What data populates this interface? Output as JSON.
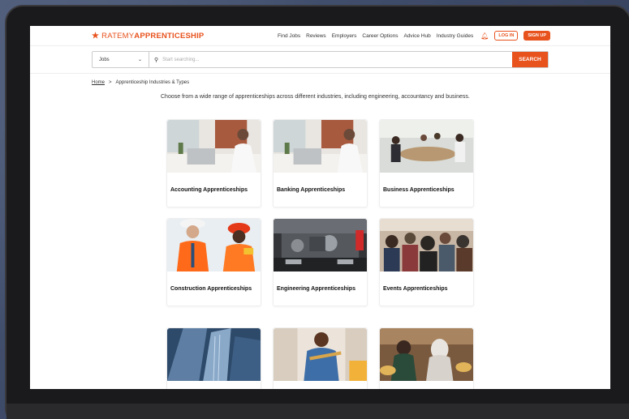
{
  "brand": {
    "prefix": "RATEMY",
    "name": "APPRENTICESHIP"
  },
  "nav": {
    "links": [
      "Find Jobs",
      "Reviews",
      "Employers",
      "Career Options",
      "Advice Hub",
      "Industry Guides"
    ],
    "login": "LOG IN",
    "signup": "SIGN UP"
  },
  "search": {
    "select_value": "Jobs",
    "placeholder": "Start searching...",
    "button": "SEARCH"
  },
  "breadcrumb": {
    "home": "Home",
    "separator": ">",
    "current": "Apprenticeship Industries & Types"
  },
  "intro": "Choose from a wide range of apprenticeships across different industries, including engineering, accountancy and business.",
  "cards": [
    {
      "title": "Accounting Apprenticeships"
    },
    {
      "title": "Banking Apprenticeships"
    },
    {
      "title": "Business Apprenticeships"
    },
    {
      "title": "Construction Apprenticeships"
    },
    {
      "title": "Engineering Apprenticeships"
    },
    {
      "title": "Events Apprenticeships"
    },
    {
      "title": ""
    },
    {
      "title": ""
    },
    {
      "title": ""
    }
  ],
  "colors": {
    "accent": "#e8521d"
  }
}
